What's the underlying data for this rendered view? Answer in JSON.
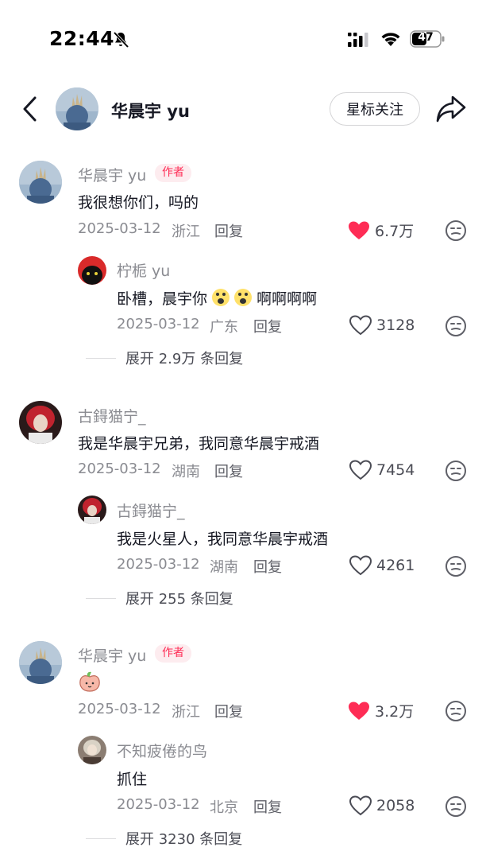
{
  "status": {
    "time": "22:44",
    "battery": "47"
  },
  "header": {
    "title": "华晨宇 yu",
    "follow_label": "星标关注"
  },
  "comments": [
    {
      "user": "华晨宇 yu",
      "badge": "作者",
      "text": "我很想你们，吗的",
      "date": "2025-03-12",
      "location": "浙江",
      "reply": "回复",
      "likes": "6.7万",
      "liked": true,
      "replies": [
        {
          "user": "柠栀 yu",
          "text_a": "卧槽，晨宇你",
          "text_b": "啊啊啊啊",
          "date": "2025-03-12",
          "location": "广东",
          "reply": "回复",
          "likes": "3128",
          "liked": false
        }
      ],
      "expand": "展开 2.9万 条回复"
    },
    {
      "user": "古鍀猫宁_",
      "text": "我是华晨宇兄弟，我同意华晨宇戒酒",
      "date": "2025-03-12",
      "location": "湖南",
      "reply": "回复",
      "likes": "7454",
      "liked": false,
      "replies": [
        {
          "user": "古鍀猫宁_",
          "text": "我是火星人，我同意华晨宇戒酒",
          "date": "2025-03-12",
          "location": "湖南",
          "reply": "回复",
          "likes": "4261",
          "liked": false
        }
      ],
      "expand": "展开 255 条回复"
    },
    {
      "user": "华晨宇 yu",
      "badge": "作者",
      "date": "2025-03-12",
      "location": "浙江",
      "reply": "回复",
      "likes": "3.2万",
      "liked": true,
      "replies": [
        {
          "user": "不知疲倦的鸟",
          "text": "抓住",
          "date": "2025-03-12",
          "location": "北京",
          "reply": "回复",
          "likes": "2058",
          "liked": false
        }
      ],
      "expand": "展开 3230 条回复"
    }
  ],
  "colors": {
    "accent": "#fe2c55",
    "text": "#161823",
    "muted": "#8a8b91"
  }
}
